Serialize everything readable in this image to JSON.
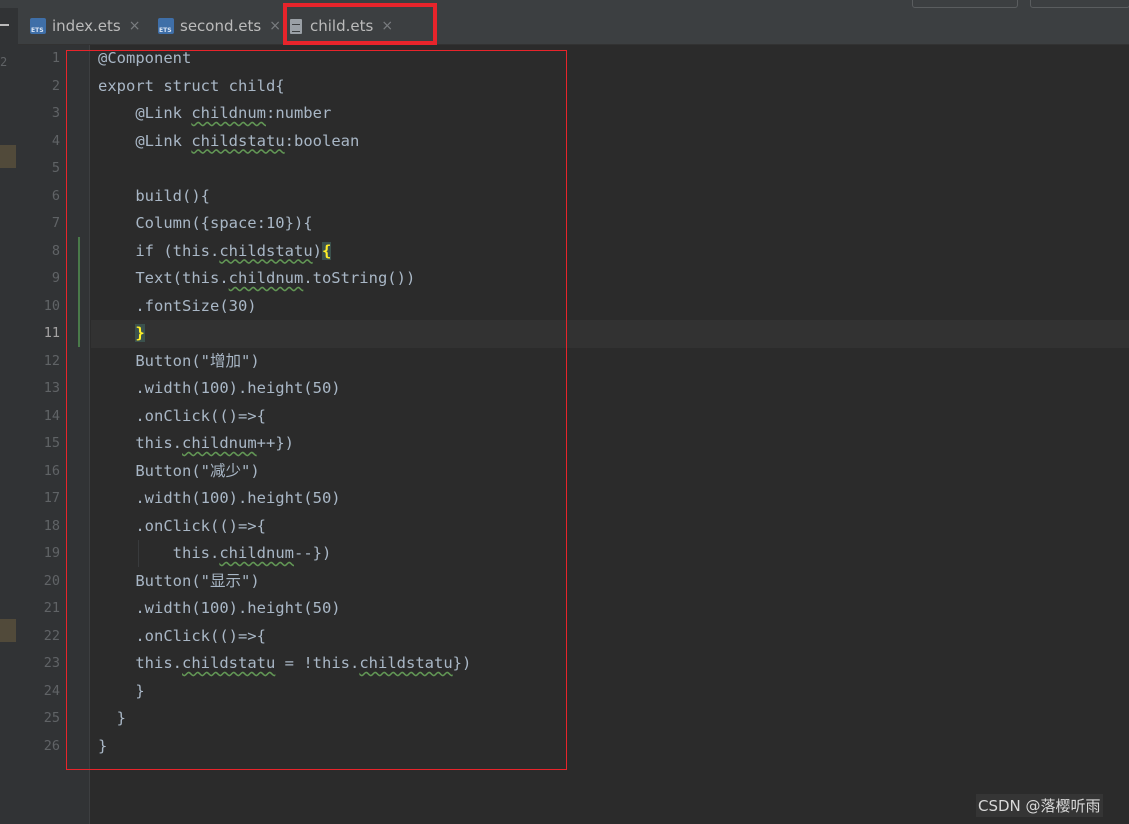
{
  "tabs": [
    {
      "label": "index.ets",
      "icon": "ets-file-icon",
      "close": "×"
    },
    {
      "label": "second.ets",
      "icon": "ets-file-icon",
      "close": "×"
    },
    {
      "label": "child.ets",
      "icon": "file-icon",
      "close": "×",
      "active": true
    }
  ],
  "left_panel": {
    "number_label": "2"
  },
  "editor": {
    "current_line": 11,
    "line_numbers": [
      "1",
      "2",
      "3",
      "4",
      "5",
      "6",
      "7",
      "8",
      "9",
      "10",
      "11",
      "12",
      "13",
      "14",
      "15",
      "16",
      "17",
      "18",
      "19",
      "20",
      "21",
      "22",
      "23",
      "24",
      "25",
      "26"
    ],
    "lines": [
      {
        "parts": [
          {
            "t": "@Component"
          }
        ]
      },
      {
        "parts": [
          {
            "t": "export struct child{"
          }
        ]
      },
      {
        "parts": [
          {
            "t": "    @Link "
          },
          {
            "t": "childnum",
            "wave": true
          },
          {
            "t": ":number"
          }
        ]
      },
      {
        "parts": [
          {
            "t": "    @Link "
          },
          {
            "t": "childstatu",
            "wave": true
          },
          {
            "t": ":boolean"
          }
        ]
      },
      {
        "parts": [
          {
            "t": ""
          }
        ]
      },
      {
        "parts": [
          {
            "t": "    build(){"
          }
        ]
      },
      {
        "parts": [
          {
            "t": "    Column({space:10}){"
          }
        ]
      },
      {
        "parts": [
          {
            "t": "    if (this."
          },
          {
            "t": "childstatu",
            "wave": true
          },
          {
            "t": ")"
          },
          {
            "t": "{",
            "hl": true
          }
        ]
      },
      {
        "parts": [
          {
            "t": "    Text(this."
          },
          {
            "t": "childnum",
            "wave": true
          },
          {
            "t": ".toString())"
          }
        ]
      },
      {
        "parts": [
          {
            "t": "    .fontSize(30)"
          }
        ]
      },
      {
        "parts": [
          {
            "t": "    "
          },
          {
            "t": "}",
            "hl": true
          }
        ]
      },
      {
        "parts": [
          {
            "t": "    Button(\"增加\")"
          }
        ]
      },
      {
        "parts": [
          {
            "t": "    .width(100).height(50)"
          }
        ]
      },
      {
        "parts": [
          {
            "t": "    .onClick(()=>{"
          }
        ]
      },
      {
        "parts": [
          {
            "t": "    this."
          },
          {
            "t": "childnum",
            "wave": true
          },
          {
            "t": "++})"
          }
        ]
      },
      {
        "parts": [
          {
            "t": "    Button(\"减少\")"
          }
        ]
      },
      {
        "parts": [
          {
            "t": "    .width(100).height(50)"
          }
        ]
      },
      {
        "parts": [
          {
            "t": "    .onClick(()=>{"
          }
        ]
      },
      {
        "parts": [
          {
            "t": "        this."
          },
          {
            "t": "childnum",
            "wave": true
          },
          {
            "t": "--})"
          }
        ]
      },
      {
        "parts": [
          {
            "t": "    Button(\"显示\")"
          }
        ]
      },
      {
        "parts": [
          {
            "t": "    .width(100).height(50)"
          }
        ]
      },
      {
        "parts": [
          {
            "t": "    .onClick(()=>{"
          }
        ]
      },
      {
        "parts": [
          {
            "t": "    this."
          },
          {
            "t": "childstatu",
            "wave": true
          },
          {
            "t": " = !this."
          },
          {
            "t": "childstatu",
            "wave": true
          },
          {
            "t": "})"
          }
        ]
      },
      {
        "parts": [
          {
            "t": "    }"
          }
        ]
      },
      {
        "parts": [
          {
            "t": "  }"
          }
        ]
      },
      {
        "parts": [
          {
            "t": "}"
          }
        ]
      }
    ]
  },
  "colors": {
    "background": "#2b2b2b",
    "text": "#a9b7c6",
    "highlight_box": "#e8242b",
    "active_tab_underline": "#4a88c7"
  },
  "watermark": "CSDN @落樱听雨"
}
